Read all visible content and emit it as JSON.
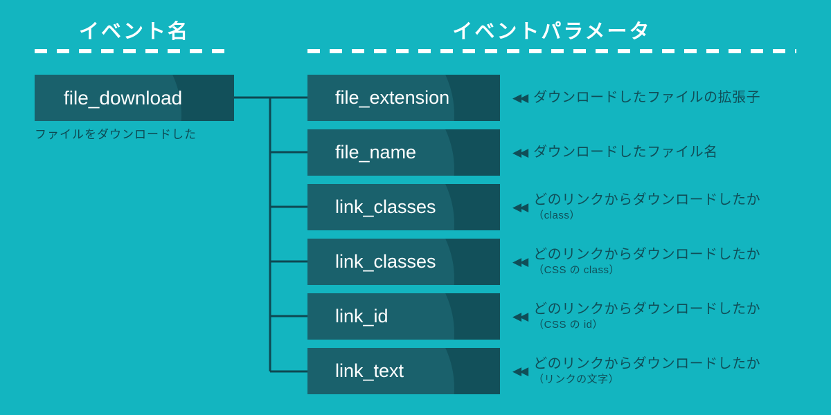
{
  "background_color": "#13b5c0",
  "box_color": "#12505a",
  "text_color_dark": "#104e58",
  "text_color_light": "#ffffff",
  "headers": {
    "event_name": "イベント名",
    "event_parameter": "イベントパラメータ"
  },
  "event": {
    "name": "file_download",
    "caption": "ファイルをダウンロードした"
  },
  "arrow_glyph": "◀◀",
  "parameters": [
    {
      "name": "file_extension",
      "description_main": "ダウンロードしたファイルの拡張子",
      "description_sub": ""
    },
    {
      "name": "file_name",
      "description_main": "ダウンロードしたファイル名",
      "description_sub": ""
    },
    {
      "name": "link_classes",
      "description_main": "どのリンクからダウンロードしたか",
      "description_sub": "（class）"
    },
    {
      "name": "link_classes",
      "description_main": "どのリンクからダウンロードしたか",
      "description_sub": "（CSS の class）"
    },
    {
      "name": "link_id",
      "description_main": "どのリンクからダウンロードしたか",
      "description_sub": "（CSS の id）"
    },
    {
      "name": "link_text",
      "description_main": "どのリンクからダウンロードしたか",
      "description_sub": "（リンクの文字）"
    }
  ]
}
